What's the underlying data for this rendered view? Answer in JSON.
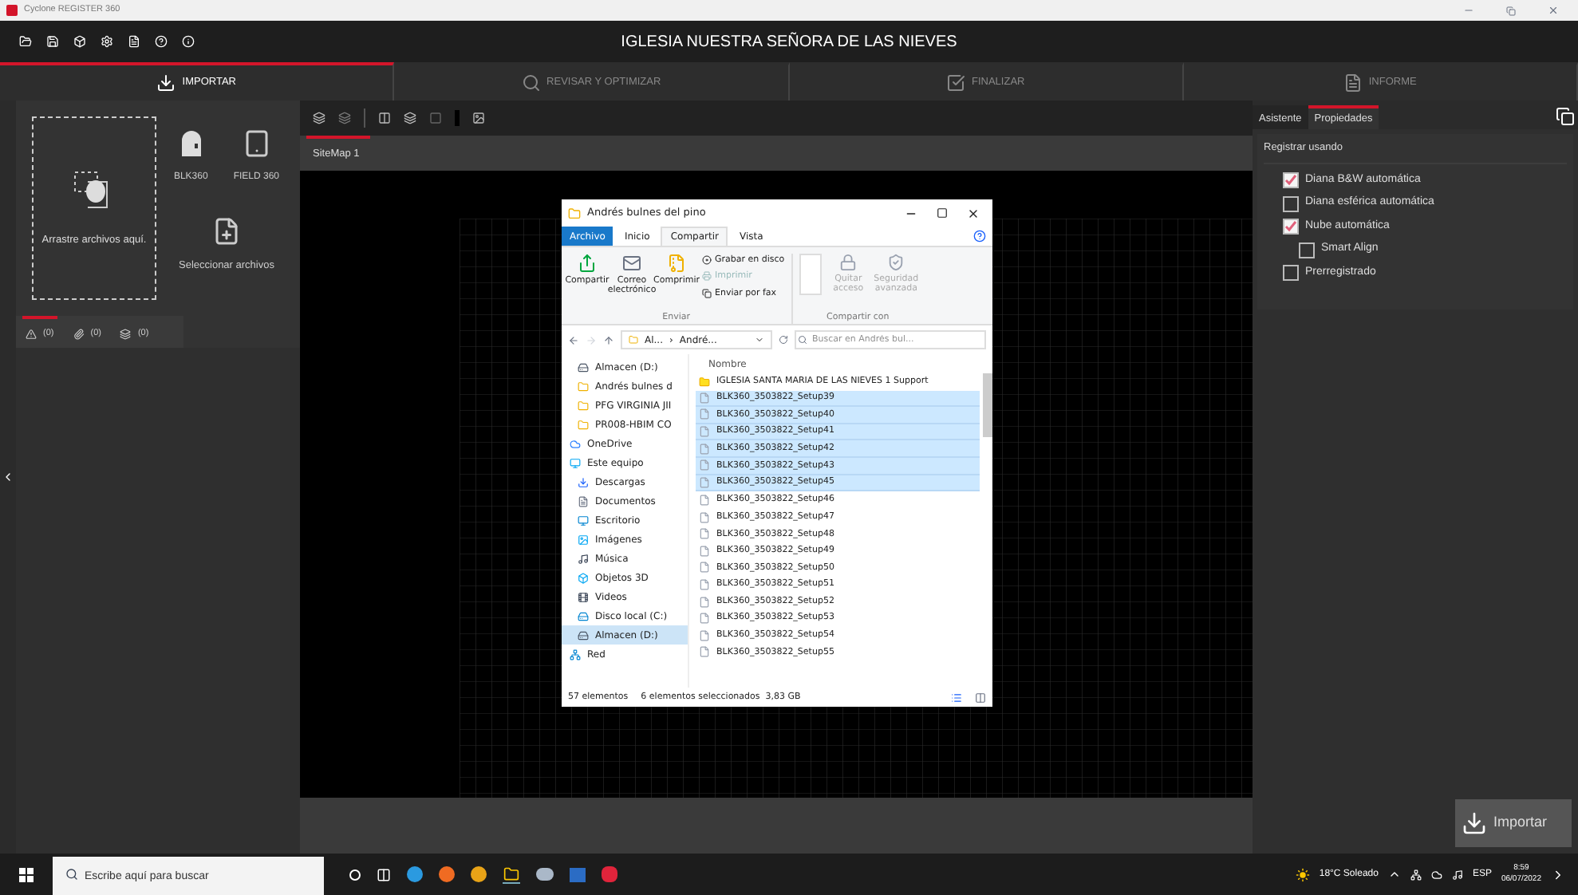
{
  "app_title": "Cyclone REGISTER 360",
  "project_title": "IGLESIA NUESTRA SEÑORA DE LAS NIEVES",
  "steps": [
    {
      "label": "IMPORTAR",
      "selected": true
    },
    {
      "label": "REVISAR Y OPTIMIZAR",
      "selected": false
    },
    {
      "label": "FINALIZAR",
      "selected": false
    },
    {
      "label": "INFORME",
      "selected": false
    }
  ],
  "import_panel": {
    "drop_text": "Arrastre archivos aquí.",
    "devices": [
      {
        "label": "BLK360",
        "kind": "scanner"
      },
      {
        "label": "FIELD 360",
        "kind": "tablet"
      }
    ],
    "select_text": "Seleccionar archivos",
    "tabs": [
      {
        "kind": "warning",
        "count": "(0)",
        "selected": true
      },
      {
        "kind": "attachment",
        "count": "(0)",
        "selected": false
      },
      {
        "kind": "layers",
        "count": "(0)",
        "selected": false
      }
    ]
  },
  "sitemap_tabs": [
    {
      "label": "SiteMap 1",
      "selected": true
    }
  ],
  "explorer": {
    "title": "Andrés bulnes del pino",
    "ribbon_tabs": [
      {
        "label": "Archivo",
        "kind": "file",
        "selected": false
      },
      {
        "label": "Inicio",
        "kind": "tab",
        "selected": false
      },
      {
        "label": "Compartir",
        "kind": "tab",
        "selected": true
      },
      {
        "label": "Vista",
        "kind": "tab",
        "selected": false
      }
    ],
    "send_group": {
      "label": "Enviar",
      "big": [
        {
          "label": "Compartir",
          "kind": "share",
          "disabled": false
        },
        {
          "label": "Correo electrónico",
          "kind": "mail",
          "disabled": false
        },
        {
          "label": "Comprimir",
          "kind": "zip",
          "disabled": false
        }
      ],
      "small": [
        {
          "label": "Grabar en disco",
          "disabled": false
        },
        {
          "label": "Imprimir",
          "disabled": true
        },
        {
          "label": "Enviar por fax",
          "disabled": false
        }
      ]
    },
    "share_group": {
      "label": "Compartir con",
      "buttons": [
        {
          "label": "Quitar acceso",
          "kind": "lock",
          "disabled": true
        },
        {
          "label": "Seguridad avanzada",
          "kind": "security",
          "disabled": true
        }
      ]
    },
    "address": {
      "part_1": "Al...",
      "separator": "›",
      "part_2": "André..."
    },
    "search": {
      "placeholder": "Buscar en Andrés bul..."
    },
    "nav": [
      {
        "label": "Almacen (D:)",
        "kind": "drive",
        "selected": false
      },
      {
        "label": "Andrés bulnes d",
        "kind": "folder",
        "selected": false
      },
      {
        "label": "PFG VIRGINIA JII",
        "kind": "folder",
        "selected": false
      },
      {
        "label": "PR008-HBIM CO",
        "kind": "folder",
        "selected": false
      },
      {
        "label": "OneDrive",
        "kind": "cloud",
        "selected": false
      },
      {
        "label": "Este equipo",
        "kind": "pc",
        "selected": false,
        "children": [
          {
            "label": "Descargas",
            "kind": "download",
            "selected": false
          },
          {
            "label": "Documentos",
            "kind": "docs",
            "selected": false
          },
          {
            "label": "Escritorio",
            "kind": "desktop",
            "selected": false
          },
          {
            "label": "Imágenes",
            "kind": "images",
            "selected": false
          },
          {
            "label": "Música",
            "kind": "music",
            "selected": false
          },
          {
            "label": "Objetos 3D",
            "kind": "objects",
            "selected": false
          },
          {
            "label": "Videos",
            "kind": "videos",
            "selected": false
          },
          {
            "label": "Disco local (C:)",
            "kind": "disk",
            "selected": false
          },
          {
            "label": "Almacen (D:)",
            "kind": "drive",
            "selected": true
          }
        ]
      },
      {
        "label": "Red",
        "kind": "network",
        "selected": false
      }
    ],
    "column": "Nombre",
    "files": [
      {
        "name": "IGLESIA SANTA MARIA DE LAS NIEVES 1 Support",
        "kind": "folder",
        "selected": false
      },
      {
        "name": "BLK360_3503822_Setup39",
        "kind": "file",
        "selected": true
      },
      {
        "name": "BLK360_3503822_Setup40",
        "kind": "file",
        "selected": true
      },
      {
        "name": "BLK360_3503822_Setup41",
        "kind": "file",
        "selected": true
      },
      {
        "name": "BLK360_3503822_Setup42",
        "kind": "file",
        "selected": true
      },
      {
        "name": "BLK360_3503822_Setup43",
        "kind": "file",
        "selected": true
      },
      {
        "name": "BLK360_3503822_Setup45",
        "kind": "file",
        "selected": true
      },
      {
        "name": "BLK360_3503822_Setup46",
        "kind": "file",
        "selected": false
      },
      {
        "name": "BLK360_3503822_Setup47",
        "kind": "file",
        "selected": false
      },
      {
        "name": "BLK360_3503822_Setup48",
        "kind": "file",
        "selected": false
      },
      {
        "name": "BLK360_3503822_Setup49",
        "kind": "file",
        "selected": false
      },
      {
        "name": "BLK360_3503822_Setup50",
        "kind": "file",
        "selected": false
      },
      {
        "name": "BLK360_3503822_Setup51",
        "kind": "file",
        "selected": false
      },
      {
        "name": "BLK360_3503822_Setup52",
        "kind": "file",
        "selected": false
      },
      {
        "name": "BLK360_3503822_Setup53",
        "kind": "file",
        "selected": false
      },
      {
        "name": "BLK360_3503822_Setup54",
        "kind": "file",
        "selected": false
      },
      {
        "name": "BLK360_3503822_Setup55",
        "kind": "file",
        "selected": false
      }
    ],
    "status_count": "57 elementos",
    "status_selection": "6 elementos seleccionados  3,83 GB"
  },
  "right_panel": {
    "tabs": [
      {
        "label": "Asistente",
        "selected": false
      },
      {
        "label": "Propiedades",
        "selected": true
      }
    ],
    "section": "Registrar usando",
    "options": [
      {
        "label": "Diana B&W automática",
        "checked": true
      },
      {
        "label": "Diana esférica automática",
        "checked": false
      },
      {
        "label": "Nube automática",
        "checked": true,
        "children": [
          {
            "label": "Smart Align",
            "checked": false
          }
        ]
      },
      {
        "label": "Prerregistrado",
        "checked": false
      }
    ]
  },
  "import_button": "Importar",
  "taskbar": {
    "search_placeholder": "Escribe aquí para buscar",
    "weather": "18°C Soleado",
    "language": "ESP",
    "time": "8:59",
    "date": "06/07/2022"
  }
}
